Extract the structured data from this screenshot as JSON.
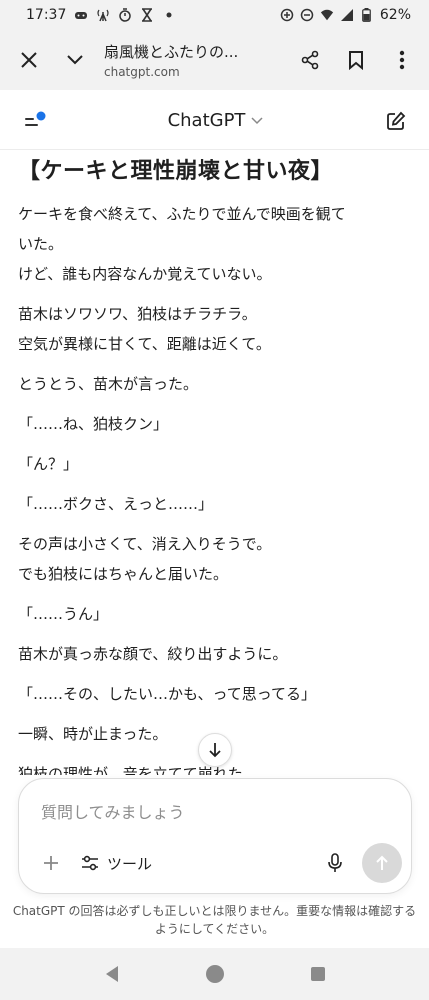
{
  "status": {
    "time": "17:37",
    "battery": "62%",
    "left_icons": [
      "game-icon",
      "signal-tower-icon",
      "timer-icon",
      "hourglass-icon",
      "dot-icon"
    ],
    "right_icons": [
      "data-saver-icon",
      "dnd-icon",
      "wifi-icon",
      "cell-signal-icon",
      "battery-icon"
    ]
  },
  "browser": {
    "title": "扇風機とふたりの...",
    "url": "chatgpt.com"
  },
  "app": {
    "title": "ChatGPT",
    "accent": "#1a73e8"
  },
  "article": {
    "heading": "【ケーキと理性崩壊と甘い夜】",
    "paragraphs": [
      [
        "ケーキを食べ終えて、ふたりで並んで映画を観て",
        "いた。",
        "けど、誰も内容なんか覚えていない。"
      ],
      [
        "苗木はソワソワ、狛枝はチラチラ。",
        "空気が異様に甘くて、距離は近くて。"
      ],
      [
        "とうとう、苗木が言った。"
      ],
      [
        "「……ね、狛枝クン」"
      ],
      [
        "「ん？」"
      ],
      [
        "「……ボクさ、えっと……」"
      ],
      [
        "その声は小さくて、消え入りそうで。",
        "でも狛枝にはちゃんと届いた。"
      ],
      [
        "「……うん」"
      ],
      [
        "苗木が真っ赤な顔で、絞り出すように。"
      ],
      [
        "「……その、したい…かも、って思ってる」"
      ],
      [
        "一瞬、時が止まった。"
      ]
    ],
    "partial_line": "狛枝の理性が、音を立てて崩れた"
  },
  "composer": {
    "placeholder": "質問してみましょう",
    "tools_label": "ツール"
  },
  "disclaimer": "ChatGPT の回答は必ずしも正しいとは限りません。重要な情報は確認するようにしてください。"
}
